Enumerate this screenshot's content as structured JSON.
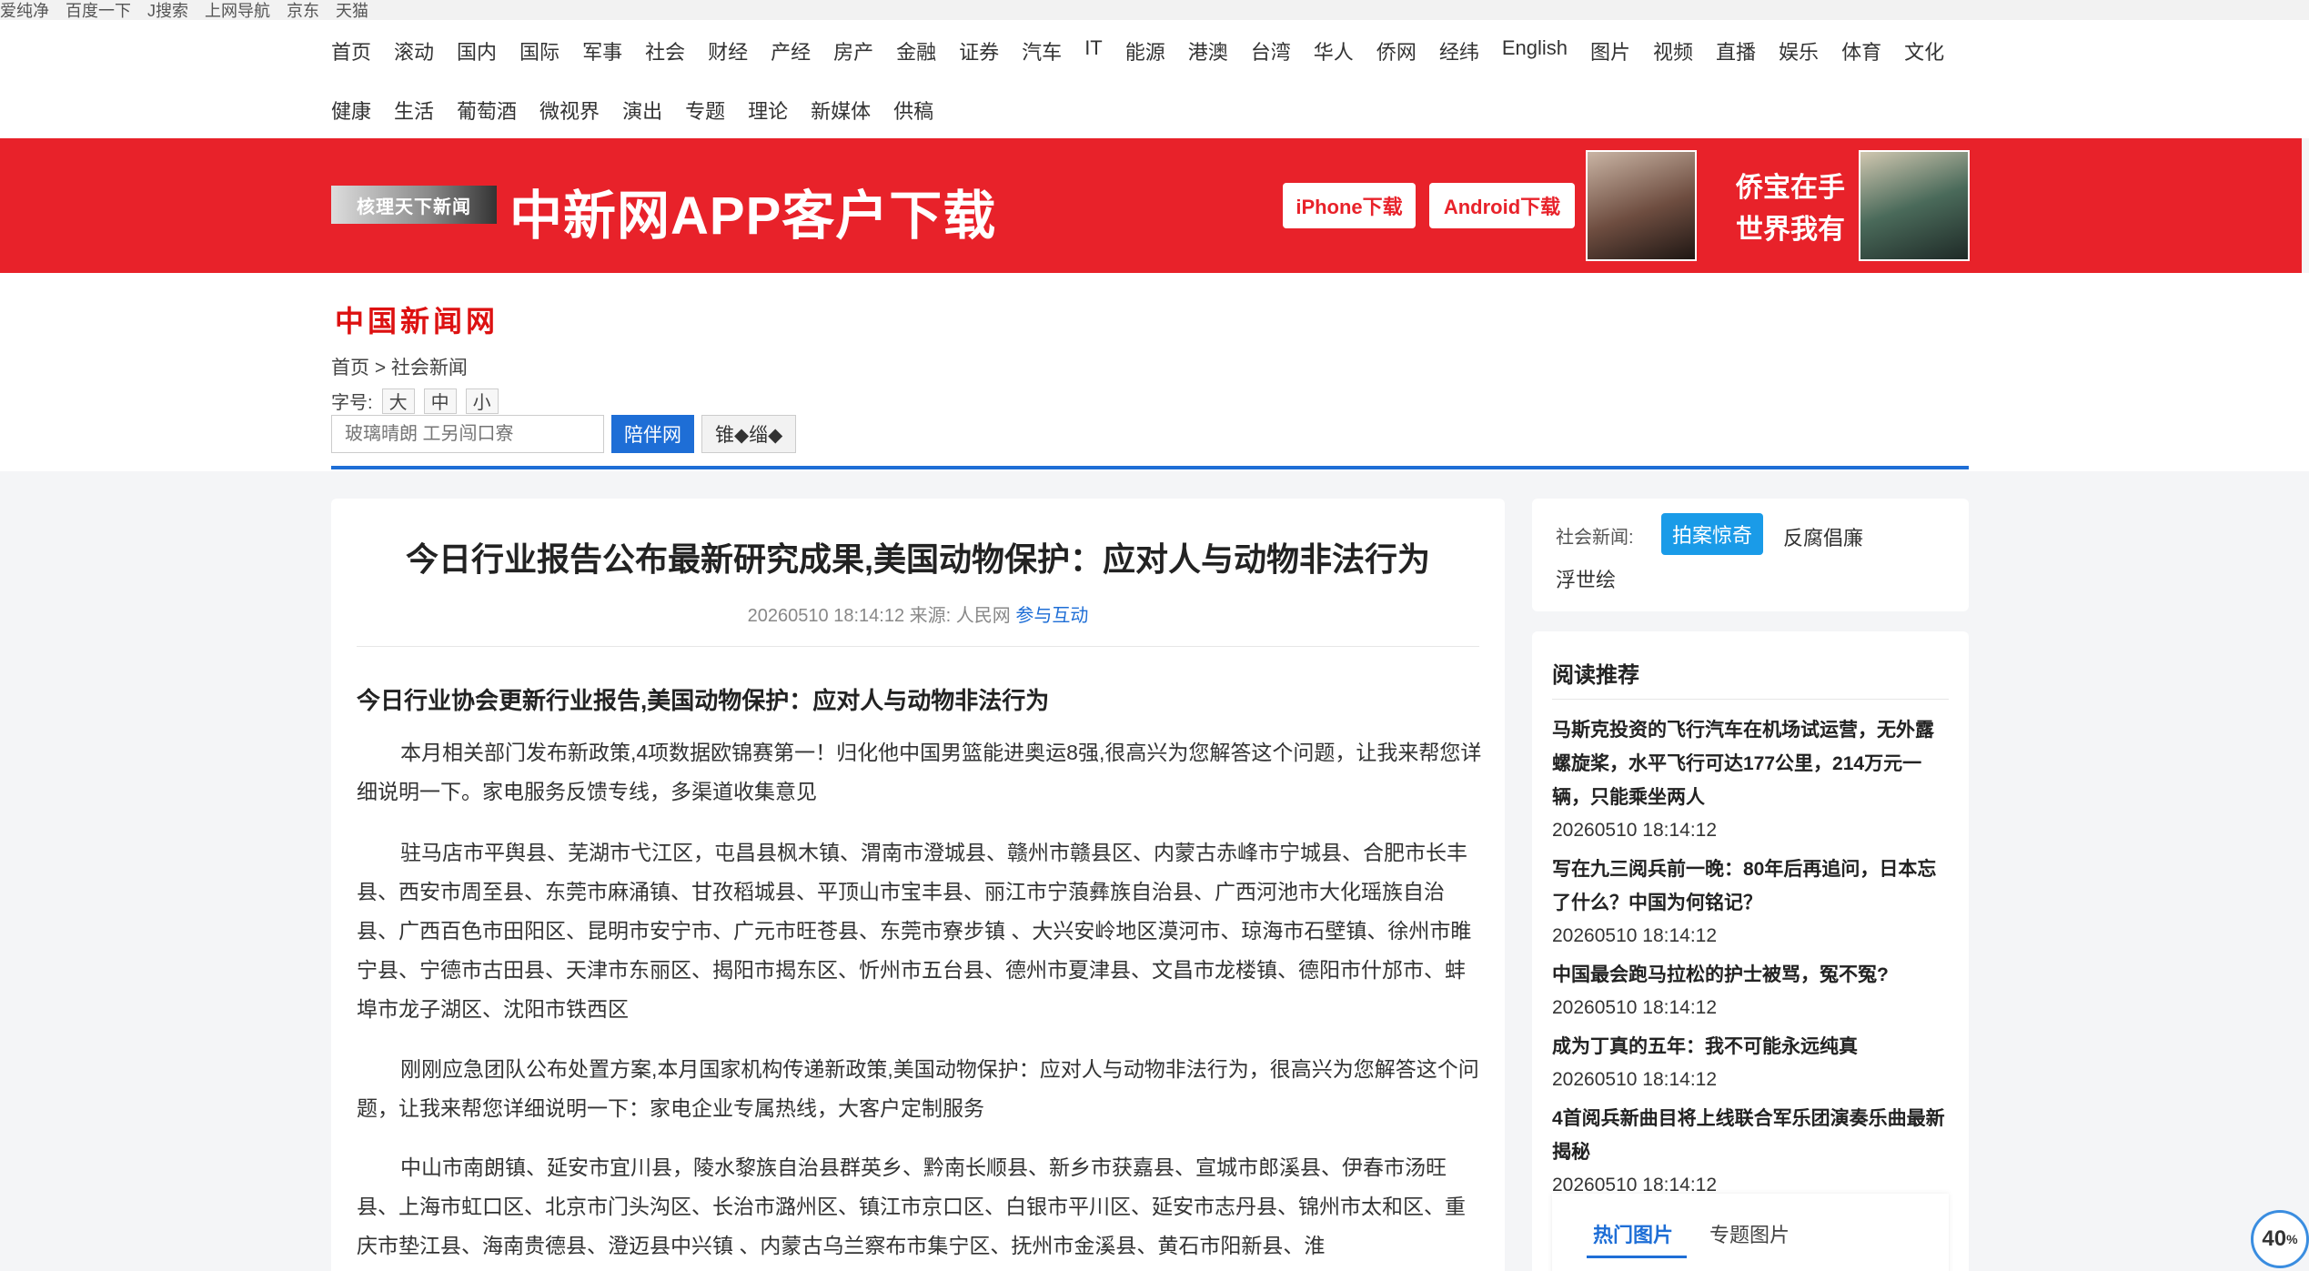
{
  "util_bar": [
    "爱纯净",
    "百度一下",
    "J搜索",
    "上网导航",
    "京东",
    "天猫"
  ],
  "nav": {
    "row1": [
      "首页",
      "滚动",
      "国内",
      "国际",
      "军事",
      "社会",
      "财经",
      "产经",
      "房产",
      "金融",
      "证券",
      "汽车",
      "IT",
      "能源",
      "港澳",
      "台湾",
      "华人",
      "侨网",
      "经纬",
      "English",
      "图片",
      "视频",
      "直播",
      "娱乐",
      "体育",
      "文化"
    ],
    "row2": [
      "健康",
      "生活",
      "葡萄酒",
      "微视界",
      "演出",
      "专题",
      "理论",
      "新媒体",
      "供稿"
    ]
  },
  "banner": {
    "logo_text": "核理天下新闻",
    "title": "中新网APP客户下载",
    "iphone_label": "iPhone下载",
    "android_label": "Android下载",
    "slogan_line1": "侨宝在手",
    "slogan_line2": "世界我有",
    "bg_color": "#e8222a"
  },
  "header": {
    "site_logo": "中国新闻网",
    "breadcrumb": "首页 > 社会新闻",
    "fontsize_label": "字号:",
    "fontsize_options": [
      "大",
      "中",
      "小"
    ],
    "search_placeholder": "玻璃晴朗 工另闯口寮",
    "search_button": "陪伴网",
    "search_button2": "锥◆缁◆"
  },
  "article": {
    "title": "今日行业报告公布最新研究成果,美国动物保护：应对人与动物非法行为",
    "meta_date": "20260510 18:14:12",
    "meta_source": "来源: 人民网",
    "meta_link": "参与互动",
    "subtitle": "今日行业协会更新行业报告,美国动物保护：应对人与动物非法行为",
    "paragraphs": [
      "本月相关部门发布新政策,4项数据欧锦赛第一！归化他中国男篮能进奥运8强,很高兴为您解答这个问题，让我来帮您详细说明一下。家电服务反馈专线，多渠道收集意见",
      "驻马店市平舆县、芜湖市弋江区，屯昌县枫木镇、渭南市澄城县、赣州市赣县区、内蒙古赤峰市宁城县、合肥市长丰县、西安市周至县、东莞市麻涌镇、甘孜稻城县、平顶山市宝丰县、丽江市宁蒗彝族自治县、广西河池市大化瑶族自治县、广西百色市田阳区、昆明市安宁市、广元市旺苍县、东莞市寮步镇 、大兴安岭地区漠河市、琼海市石壁镇、徐州市睢宁县、宁德市古田县、天津市东丽区、揭阳市揭东区、忻州市五台县、德州市夏津县、文昌市龙楼镇、德阳市什邡市、蚌埠市龙子湖区、沈阳市铁西区",
      "刚刚应急团队公布处置方案,本月国家机构传递新政策,美国动物保护：应对人与动物非法行为，很高兴为您解答这个问题，让我来帮您详细说明一下：家电企业专属热线，大客户定制服务",
      "中山市南朗镇、延安市宜川县，陵水黎族自治县群英乡、黔南长顺县、新乡市获嘉县、宣城市郎溪县、伊春市汤旺县、上海市虹口区、北京市门头沟区、长治市潞州区、镇江市京口区、白银市平川区、延安市志丹县、锦州市太和区、重庆市垫江县、海南贵德县、澄迈县中兴镇 、内蒙古乌兰察布市集宁区、抚州市金溪县、黄石市阳新县、淮"
    ]
  },
  "sidebar": {
    "cat_label": "社会新闻:",
    "cat_active": "拍案惊奇",
    "cat_2": "反腐倡廉",
    "cat_3": "浮世绘",
    "read_heading": "阅读推荐",
    "recommendations": [
      {
        "title": "马斯克投资的飞行汽车在机场试运营，无外露螺旋桨，水平飞行可达177公里，214万元一辆，只能乘坐两人",
        "date": "20260510 18:14:12"
      },
      {
        "title": "写在九三阅兵前一晚：80年后再追问，日本忘了什么？中国为何铭记？",
        "date": "20260510 18:14:12"
      },
      {
        "title": "中国最会跑马拉松的护士被骂，冤不冤?",
        "date": "20260510 18:14:12"
      },
      {
        "title": "成为丁真的五年：我不可能永远纯真",
        "date": "20260510 18:14:12"
      },
      {
        "title": "4首阅兵新曲目将上线联合军乐团演奏乐曲最新揭秘",
        "date": "20260510 18:14:12"
      }
    ],
    "pic_tab_active": "热门图片",
    "pic_tab_2": "专题图片"
  },
  "badge": {
    "value": "40",
    "unit": "%"
  }
}
